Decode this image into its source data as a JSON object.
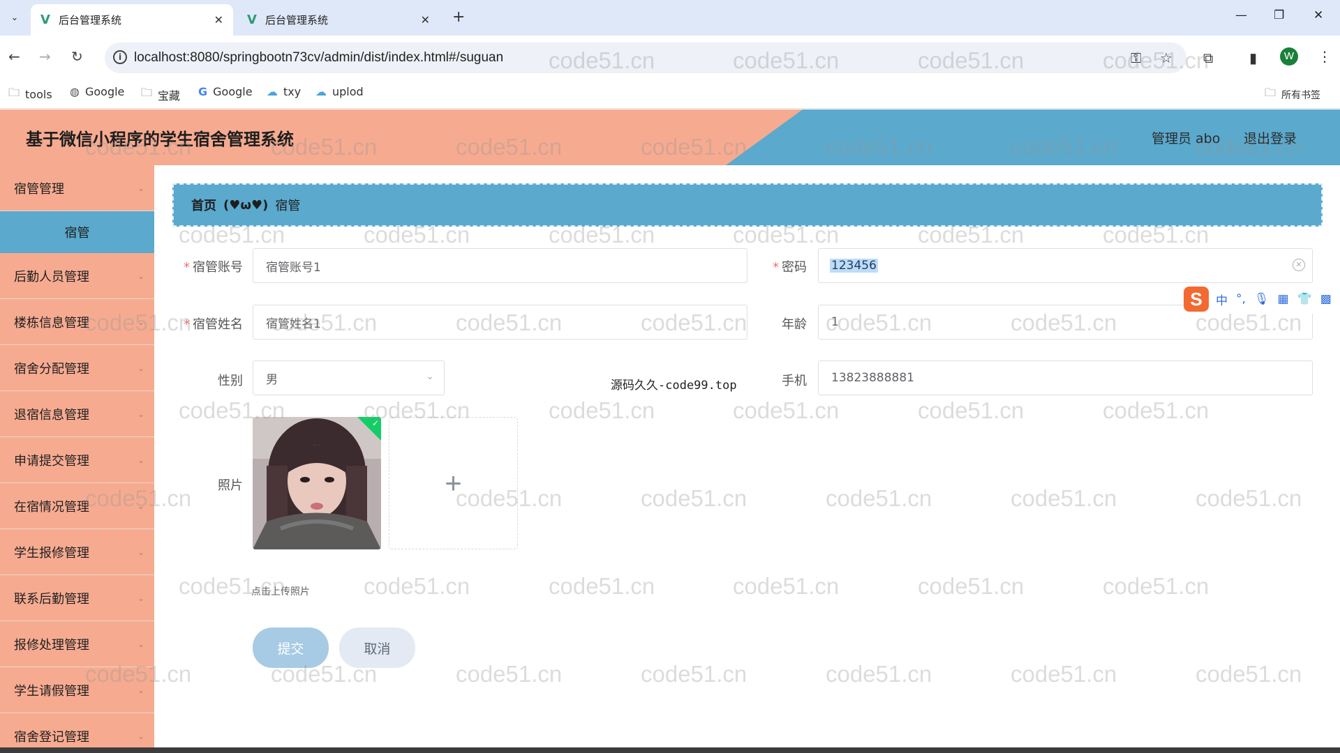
{
  "browser": {
    "tabs": [
      {
        "title": "后台管理系统",
        "active": true
      },
      {
        "title": "后台管理系统",
        "active": false
      }
    ],
    "url": "localhost:8080/springbootn73cv/admin/dist/index.html#/suguan",
    "profile_initial": "W",
    "bookmarks": [
      {
        "label": "tools",
        "icon": "folder-icon"
      },
      {
        "label": "Google",
        "icon": "globe-icon"
      },
      {
        "label": "宝藏",
        "icon": "folder-icon"
      },
      {
        "label": "Google",
        "icon": "google-icon"
      },
      {
        "label": "txy",
        "icon": "cloud-icon"
      },
      {
        "label": "uplod",
        "icon": "cloud-icon"
      }
    ],
    "all_bookmarks": "所有书签"
  },
  "header": {
    "title": "基于微信小程序的学生宿舍管理系统",
    "user": "管理员 abo",
    "logout": "退出登录"
  },
  "sidebar": {
    "items": [
      {
        "label": "宿管管理"
      },
      {
        "label": "后勤人员管理"
      },
      {
        "label": "楼栋信息管理"
      },
      {
        "label": "宿舍分配管理"
      },
      {
        "label": "退宿信息管理"
      },
      {
        "label": "申请提交管理"
      },
      {
        "label": "在宿情况管理"
      },
      {
        "label": "学生报修管理"
      },
      {
        "label": "联系后勤管理"
      },
      {
        "label": "报修处理管理"
      },
      {
        "label": "学生请假管理"
      },
      {
        "label": "宿舍登记管理"
      }
    ],
    "active_sub": "宿管"
  },
  "breadcrumb": {
    "home": "首页",
    "separator": "(♥ω♥)",
    "current": "宿管"
  },
  "form": {
    "account_label": "宿管账号",
    "account_value": "宿管账号1",
    "password_label": "密码",
    "password_value": "123456",
    "name_label": "宿管姓名",
    "name_value": "宿管姓名1",
    "age_label": "年龄",
    "age_value": "1",
    "gender_label": "性别",
    "gender_value": "男",
    "phone_label": "手机",
    "phone_value": "13823888881",
    "photo_label": "照片",
    "upload_plus": "+",
    "photo_hint": "点击上传照片",
    "submit": "提交",
    "cancel": "取消"
  },
  "overlay_note": "源码久久-code99.top",
  "ime": {
    "letter": "S",
    "mode": "中",
    "punct": "°,"
  },
  "watermark": "code51.cn",
  "colors": {
    "header_salmon": "#f6ab91",
    "accent_blue": "#5ba9cd",
    "required": "#f56c6c"
  }
}
